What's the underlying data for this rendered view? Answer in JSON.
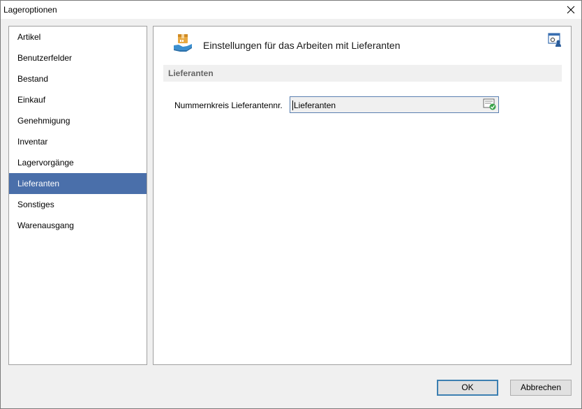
{
  "window": {
    "title": "Lageroptionen"
  },
  "nav": {
    "items": [
      {
        "label": "Artikel"
      },
      {
        "label": "Benutzerfelder"
      },
      {
        "label": "Bestand"
      },
      {
        "label": "Einkauf"
      },
      {
        "label": "Genehmigung"
      },
      {
        "label": "Inventar"
      },
      {
        "label": "Lagervorgänge"
      },
      {
        "label": "Lieferanten",
        "selected": true
      },
      {
        "label": "Sonstiges"
      },
      {
        "label": "Warenausgang"
      }
    ]
  },
  "content": {
    "header_title": "Einstellungen für das Arbeiten mit Lieferanten",
    "header_icon": "package-hand-icon",
    "settings_icon": "settings-user-icon",
    "section_title": "Lieferanten",
    "fields": [
      {
        "label": "Nummernkreis Lieferantennr.",
        "value": "Lieferanten",
        "picker_icon": "number-range-picker-icon"
      }
    ]
  },
  "buttons": {
    "ok": "OK",
    "cancel": "Abbrechen"
  },
  "colors": {
    "selected_nav": "#4a6faa",
    "section_bar": "#f0f0f0",
    "focus_border": "#3c7fb1"
  }
}
